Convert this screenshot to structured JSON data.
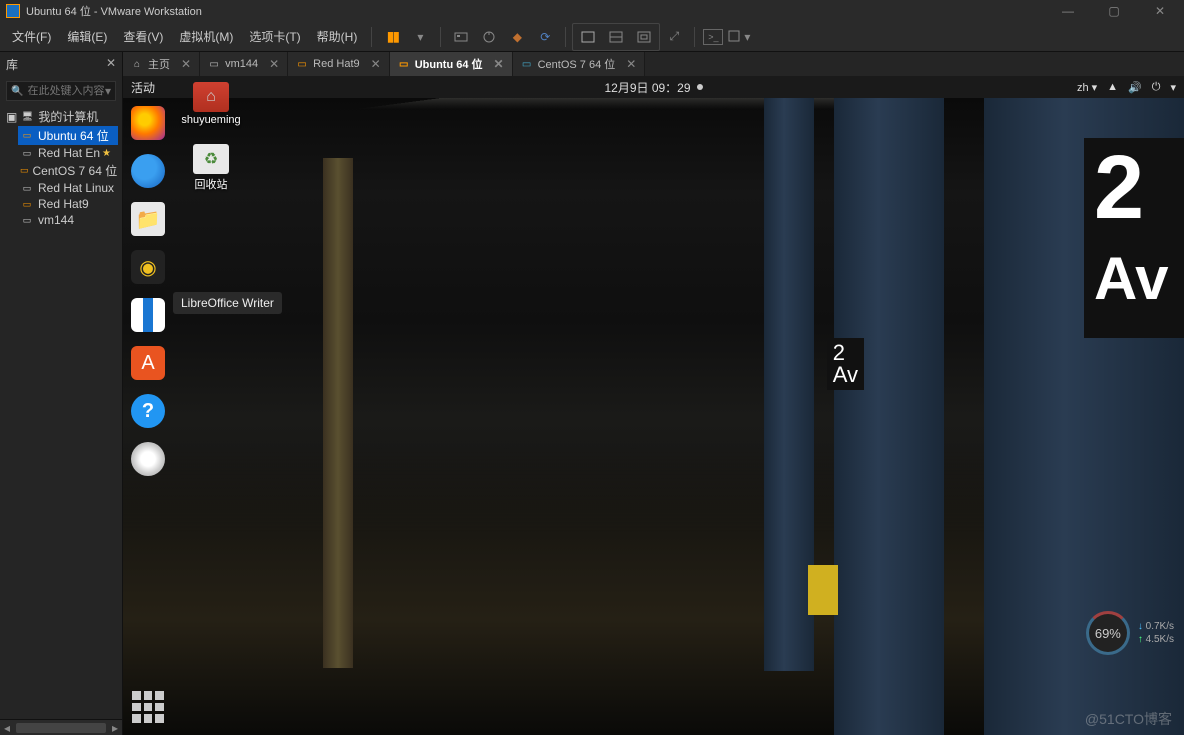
{
  "titlebar": {
    "title": "Ubuntu 64 位 - VMware Workstation"
  },
  "menu": {
    "file": "文件(F)",
    "edit": "编辑(E)",
    "view": "查看(V)",
    "vm": "虚拟机(M)",
    "tabs": "选项卡(T)",
    "help": "帮助(H)"
  },
  "sidebar": {
    "title": "库",
    "search_placeholder": "在此处键入内容...",
    "root": "我的计算机",
    "items": [
      {
        "label": "Ubuntu 64 位",
        "selected": true
      },
      {
        "label": "Red Hat En",
        "star": true
      },
      {
        "label": "CentOS 7 64 位"
      },
      {
        "label": "Red Hat Linux"
      },
      {
        "label": "Red Hat9"
      },
      {
        "label": "vm144"
      }
    ]
  },
  "tabs": [
    {
      "icon": "home",
      "label": "主页"
    },
    {
      "icon": "vm",
      "label": "vm144"
    },
    {
      "icon": "rh",
      "label": "Red Hat9"
    },
    {
      "icon": "ubuntu",
      "label": "Ubuntu 64 位",
      "active": true
    },
    {
      "icon": "centos",
      "label": "CentOS 7 64 位"
    }
  ],
  "gnome": {
    "activities": "活动",
    "datetime": "12月9日 09：29",
    "lang": "zh",
    "dock": [
      {
        "id": "firefox",
        "name": "Firefox"
      },
      {
        "id": "thunderbird",
        "name": "Thunderbird"
      },
      {
        "id": "files",
        "name": "Files"
      },
      {
        "id": "rhythmbox",
        "name": "Rhythmbox"
      },
      {
        "id": "writer",
        "name": "LibreOffice Writer"
      },
      {
        "id": "software",
        "name": "Ubuntu Software"
      },
      {
        "id": "help",
        "name": "Help"
      },
      {
        "id": "dvd",
        "name": "DVD"
      }
    ],
    "tooltip": "LibreOffice Writer",
    "desktop_icons": [
      {
        "id": "home-folder",
        "label": "shuyueming",
        "kind": "folder"
      },
      {
        "id": "trash",
        "label": "回收站",
        "kind": "trash"
      }
    ],
    "subway_sign_big": "2",
    "subway_sign_big2": "Av",
    "subway_sign_small": "2\nAv"
  },
  "net": {
    "percent": "69%",
    "down": "0.7K/s",
    "up": "4.5K/s"
  },
  "watermark": "@51CTO博客"
}
